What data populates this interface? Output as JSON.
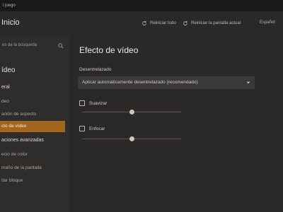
{
  "window": {
    "title": "l juego"
  },
  "header": {
    "home_label": "Inicio",
    "reset_all_label": "Reiniciar todo",
    "reset_screen_label": "Reiniciar la pantalla actual",
    "language_label": "Español"
  },
  "sidebar": {
    "search_placeholder": "es de la búsqueda",
    "section_label": "ídeo",
    "items": [
      {
        "label": "eral",
        "type": "group"
      },
      {
        "label": "deo",
        "type": "item"
      },
      {
        "label": "ación de aspecto",
        "type": "item"
      },
      {
        "label": "cto de vídeo",
        "type": "item",
        "active": true
      },
      {
        "label": "aciones avanzadas",
        "type": "group"
      },
      {
        "label": "ecio de color",
        "type": "item"
      },
      {
        "label": "maño de la pantalla",
        "type": "item"
      },
      {
        "label": "itar bloque",
        "type": "item"
      }
    ]
  },
  "main": {
    "page_title": "Efecto de vídeo",
    "deinterlace": {
      "label": "Desentrelazado",
      "selected": "Aplicar automáticamente desentrelazado (recomendado)"
    },
    "smooth": {
      "label": "Suavizar",
      "checked": false,
      "slider_fraction": 0.5
    },
    "sharpen": {
      "label": "Enfocar",
      "checked": false,
      "slider_fraction": 0.5
    }
  },
  "colors": {
    "accent": "#a0661e",
    "background": "#2b2928",
    "sidebar": "#2f2d2b"
  }
}
